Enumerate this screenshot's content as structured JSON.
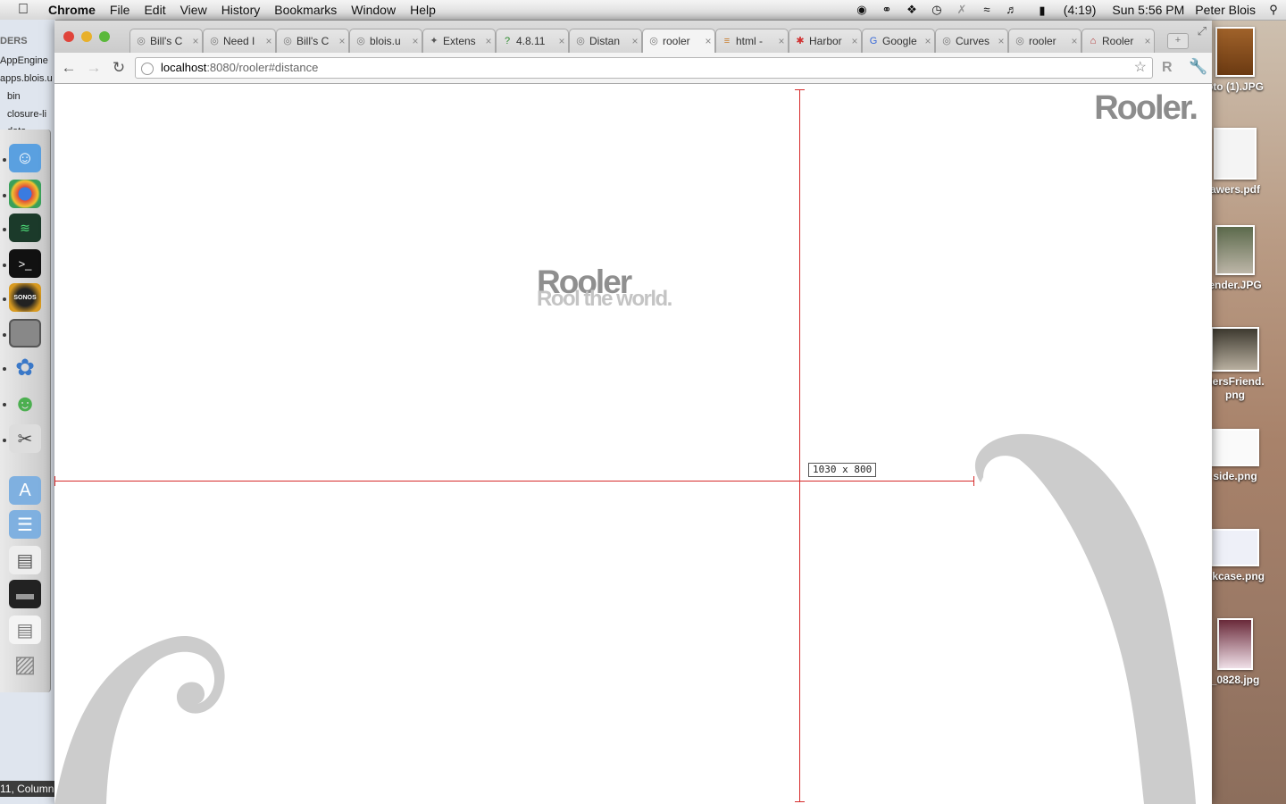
{
  "menubar": {
    "app_name": "Chrome",
    "menus": [
      "File",
      "Edit",
      "View",
      "History",
      "Bookmarks",
      "Window",
      "Help"
    ],
    "battery": "(4:19)",
    "clock": "Sun 5:56 PM",
    "user": "Peter Blois"
  },
  "finder_sidebar": {
    "items": [
      "DERS",
      "AppEngine",
      "apps.blois.u",
      "bin",
      "closure-li",
      "data"
    ],
    "status": "11, Column"
  },
  "desktop_files": {
    "items": [
      "oto (1).JPG",
      "awers.pdf",
      "ender.JPG",
      "dersFriend.\npng",
      "side.png",
      "okcase.png",
      "_0828.jpg"
    ]
  },
  "browser": {
    "tabs": [
      {
        "title": "Bill's C",
        "icon": "globe-icon"
      },
      {
        "title": "Need I",
        "icon": "globe-icon"
      },
      {
        "title": "Bill's C",
        "icon": "globe-icon"
      },
      {
        "title": "blois.u",
        "icon": "globe-icon"
      },
      {
        "title": "Extens",
        "icon": "puzzle-icon"
      },
      {
        "title": "4.8.11",
        "icon": "help-icon"
      },
      {
        "title": "Distan",
        "icon": "globe-icon"
      },
      {
        "title": "rooler",
        "icon": "globe-icon",
        "active": true
      },
      {
        "title": "html -",
        "icon": "stack-icon"
      },
      {
        "title": "Harbor",
        "icon": "asterisk-icon"
      },
      {
        "title": "Google",
        "icon": "google-icon"
      },
      {
        "title": "Curves",
        "icon": "globe-icon"
      },
      {
        "title": "rooler",
        "icon": "globe-icon"
      },
      {
        "title": "Rooler",
        "icon": "rooler-icon"
      }
    ],
    "url_host": "localhost",
    "url_rest": ":8080/rooler#distance",
    "extension_label": "R"
  },
  "page": {
    "corner_logo": "Rooler.",
    "logo_title": "Rooler",
    "logo_tagline": "Rool the world.",
    "measurement": "1030  x  800"
  },
  "colors": {
    "ruler": "#d62a2a",
    "curl": "#cccccc",
    "logo": "#8f8f8f"
  }
}
